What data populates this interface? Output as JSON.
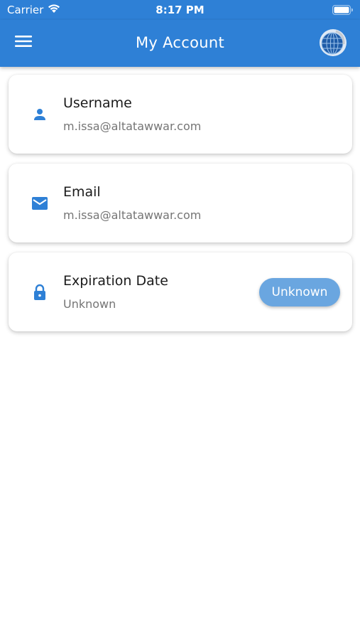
{
  "status_bar": {
    "carrier": "Carrier",
    "time": "8:17 PM",
    "wifi_icon": "wifi-icon",
    "battery_icon": "battery-icon"
  },
  "app_bar": {
    "title": "My Account",
    "menu_icon": "menu-icon",
    "avatar_icon": "globe-avatar-icon",
    "color": "#2e80d6"
  },
  "cards": [
    {
      "icon": "person-icon",
      "title": "Username",
      "value": "m.issa@altatawwar.com"
    },
    {
      "icon": "mail-icon",
      "title": "Email",
      "value": "m.issa@altatawwar.com"
    },
    {
      "icon": "lock-icon",
      "title": "Expiration Date",
      "value": "Unknown",
      "badge": "Unknown"
    }
  ],
  "colors": {
    "accent": "#2e80d6",
    "badge": "#6aa6e0",
    "icon": "#2e80d6",
    "subtitle": "#757575"
  }
}
